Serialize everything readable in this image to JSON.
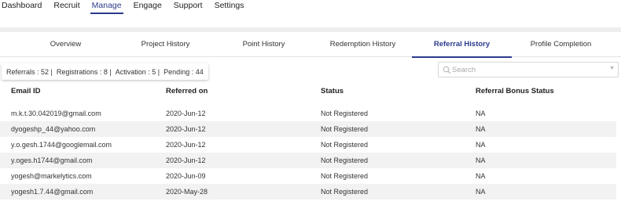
{
  "topnav": {
    "items": [
      {
        "label": "Dashboard"
      },
      {
        "label": "Recruit"
      },
      {
        "label": "Manage",
        "active": true
      },
      {
        "label": "Engage"
      },
      {
        "label": "Support"
      },
      {
        "label": "Settings"
      }
    ]
  },
  "subtabs": [
    {
      "label": "Overview"
    },
    {
      "label": "Project History"
    },
    {
      "label": "Point History"
    },
    {
      "label": "Redemption History"
    },
    {
      "label": "Referral History",
      "active": true
    },
    {
      "label": "Profile Completion"
    }
  ],
  "stats": {
    "referrals": "Referrals : 52 |",
    "registrations": "Registrations : 8 |",
    "activation": "Activation : 5 |",
    "pending": "Pending : 44"
  },
  "search": {
    "placeholder": "Search",
    "value": "",
    "icon": "search-icon",
    "caret": "▼"
  },
  "table": {
    "headers": [
      "Email ID",
      "Referred on",
      "Status",
      "Referral Bonus Status"
    ],
    "rows": [
      [
        "m.k.t.30.042019@gmail.com",
        "2020-Jun-12",
        "Not Registered",
        "NA"
      ],
      [
        "dyogeshp_44@yahoo.com",
        "2020-Jun-12",
        "Not Registered",
        "NA"
      ],
      [
        "y.o.gesh.1744@googlemail.com",
        "2020-Jun-12",
        "Not Registered",
        "NA"
      ],
      [
        "y.oges.h1744@gmail.com",
        "2020-Jun-12",
        "Not Registered",
        "NA"
      ],
      [
        "yogesh@markelytics.com",
        "2020-Jun-09",
        "Not Registered",
        "NA"
      ],
      [
        "yogesh1.7.44@gmail.com",
        "2020-May-28",
        "Not Registered",
        "NA"
      ]
    ]
  },
  "colors": {
    "accent": "#2b3a8c",
    "row_alt": "#f2f2f2"
  }
}
